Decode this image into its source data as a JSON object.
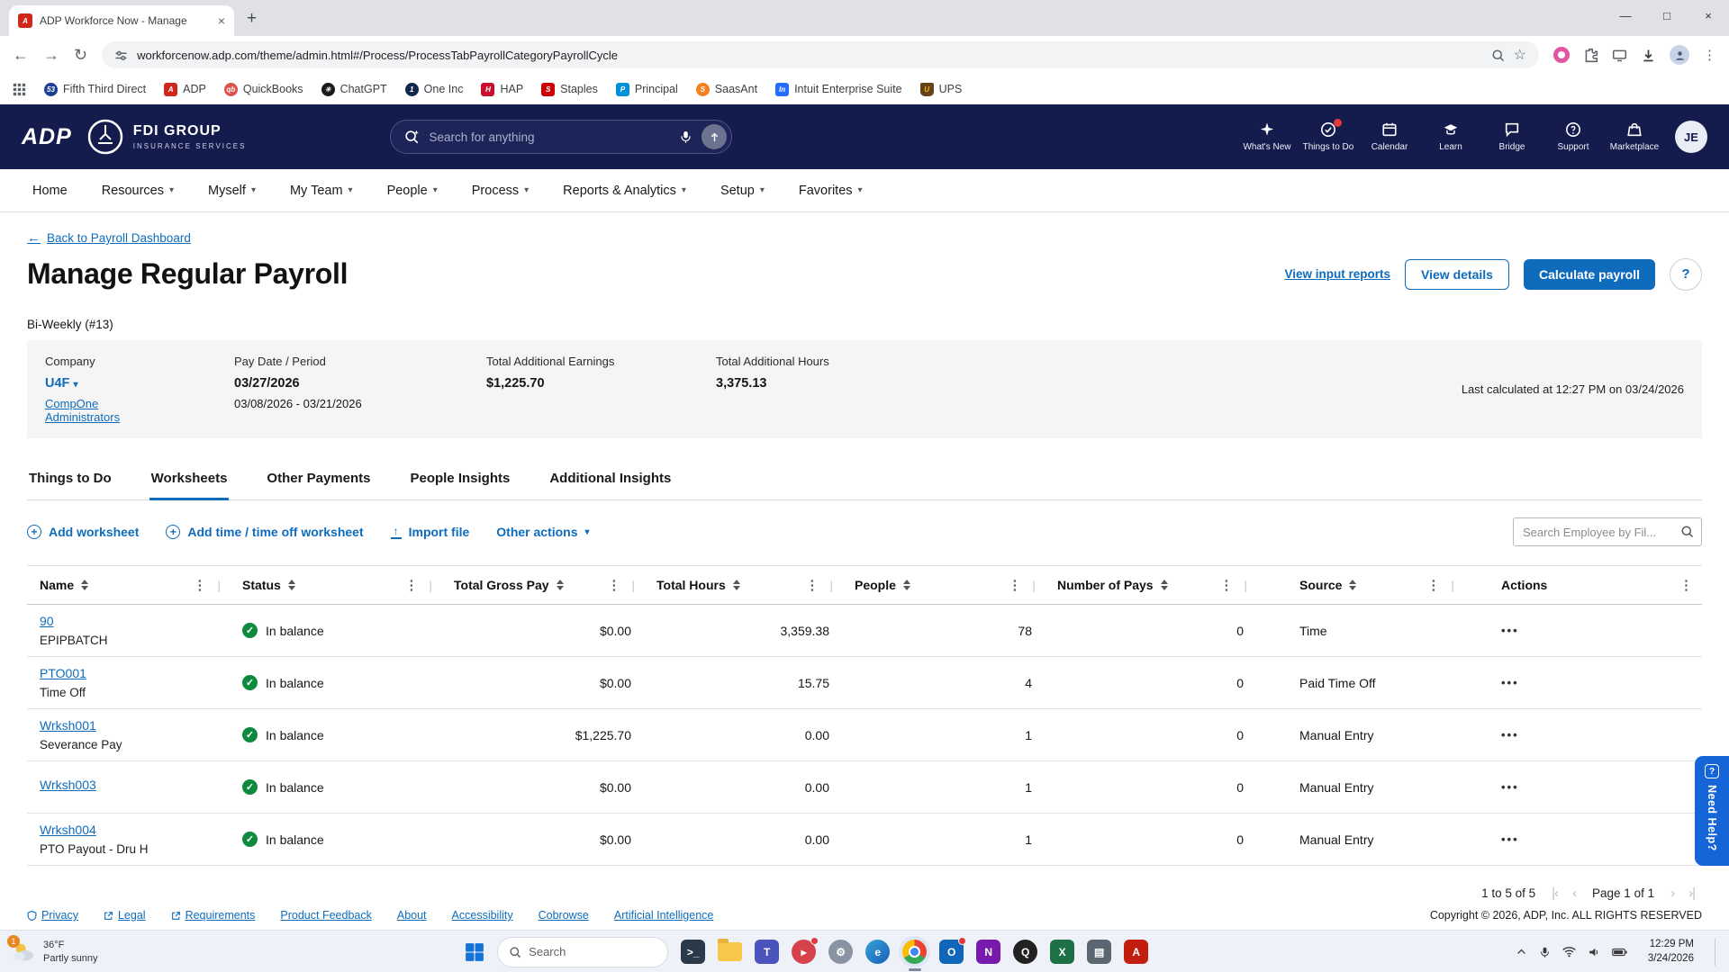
{
  "theme": {
    "header_navy": "#141b4d",
    "accent_blue": "#0f6cbd",
    "success_green": "#0e8a3e",
    "adp_red": "#d0271d",
    "need_help_blue": "#1565d8"
  },
  "browser": {
    "tab_title": "ADP Workforce Now - Manage",
    "url": "workforcenow.adp.com/theme/admin.html#/Process/ProcessTabPayrollCategoryPayrollCycle",
    "bookmarks": [
      "Fifth Third Direct",
      "ADP",
      "QuickBooks",
      "ChatGPT",
      "One Inc",
      "HAP",
      "Staples",
      "Principal",
      "SaasAnt",
      "Intuit Enterprise Suite",
      "UPS"
    ]
  },
  "header": {
    "logo_text": "ADP",
    "company_name": "FDI GROUP",
    "company_tagline": "INSURANCE SERVICES",
    "search_placeholder": "Search for anything",
    "icons": [
      {
        "label": "What's New"
      },
      {
        "label": "Things to Do"
      },
      {
        "label": "Calendar"
      },
      {
        "label": "Learn"
      },
      {
        "label": "Bridge"
      },
      {
        "label": "Support"
      },
      {
        "label": "Marketplace"
      }
    ],
    "avatar": "JE"
  },
  "nav": {
    "items": [
      {
        "label": "Home"
      },
      {
        "label": "Resources"
      },
      {
        "label": "Myself"
      },
      {
        "label": "My Team"
      },
      {
        "label": "People"
      },
      {
        "label": "Process"
      },
      {
        "label": "Reports & Analytics"
      },
      {
        "label": "Setup"
      },
      {
        "label": "Favorites"
      }
    ]
  },
  "page": {
    "back_link": "Back to Payroll Dashboard",
    "title": "Manage Regular Payroll",
    "buttons": {
      "view_input_reports": "View input reports",
      "view_details": "View details",
      "calculate_payroll": "Calculate payroll"
    },
    "cycle": "Bi-Weekly (#13)",
    "summary": {
      "company_label": "Company",
      "company_value": "U4F",
      "company_link": "CompOne Administrators",
      "pay_label": "Pay Date / Period",
      "pay_date": "03/27/2026",
      "pay_period": "03/08/2026 - 03/21/2026",
      "earnings_label": "Total Additional Earnings",
      "earnings_value": "$1,225.70",
      "hours_label": "Total Additional Hours",
      "hours_value": "3,375.13",
      "last_calculated": "Last calculated at 12:27 PM on 03/24/2026"
    },
    "tabs": [
      "Things to Do",
      "Worksheets",
      "Other Payments",
      "People Insights",
      "Additional Insights"
    ],
    "toolbar": {
      "add_worksheet": "Add worksheet",
      "add_time_worksheet": "Add time / time off worksheet",
      "import_file": "Import file",
      "other_actions": "Other actions",
      "search_placeholder": "Search Employee by Fil..."
    },
    "table": {
      "columns": [
        "Name",
        "Status",
        "Total Gross Pay",
        "Total Hours",
        "People",
        "Number of Pays",
        "Source",
        "Actions"
      ],
      "rows": [
        {
          "name": "90",
          "sub": "EPIPBATCH",
          "status": "In balance",
          "gross": "$0.00",
          "hours": "3,359.38",
          "people": "78",
          "pays": "0",
          "source": "Time"
        },
        {
          "name": "PTO001",
          "sub": "Time Off",
          "status": "In balance",
          "gross": "$0.00",
          "hours": "15.75",
          "people": "4",
          "pays": "0",
          "source": "Paid Time Off"
        },
        {
          "name": "Wrksh001",
          "sub": "Severance Pay",
          "status": "In balance",
          "gross": "$1,225.70",
          "hours": "0.00",
          "people": "1",
          "pays": "0",
          "source": "Manual Entry"
        },
        {
          "name": "Wrksh003",
          "sub": "",
          "status": "In balance",
          "gross": "$0.00",
          "hours": "0.00",
          "people": "1",
          "pays": "0",
          "source": "Manual Entry"
        },
        {
          "name": "Wrksh004",
          "sub": "PTO Payout - Dru H",
          "status": "In balance",
          "gross": "$0.00",
          "hours": "0.00",
          "people": "1",
          "pays": "0",
          "source": "Manual Entry"
        }
      ]
    },
    "pagination": {
      "range": "1 to 5 of 5",
      "page": "Page 1 of 1"
    },
    "need_help": "Need Help?"
  },
  "footer": {
    "links": [
      "Privacy",
      "Legal",
      "Requirements",
      "Product Feedback",
      "About",
      "Accessibility",
      "Cobrowse",
      "Artificial Intelligence"
    ],
    "copyright": "Copyright © 2026, ADP, Inc. ALL RIGHTS RESERVED"
  },
  "taskbar": {
    "weather": {
      "badge": "1",
      "temp": "36°F",
      "desc": "Partly sunny"
    },
    "search_placeholder": "Search",
    "clock": {
      "time": "12:29 PM",
      "date": "3/24/2026"
    }
  }
}
